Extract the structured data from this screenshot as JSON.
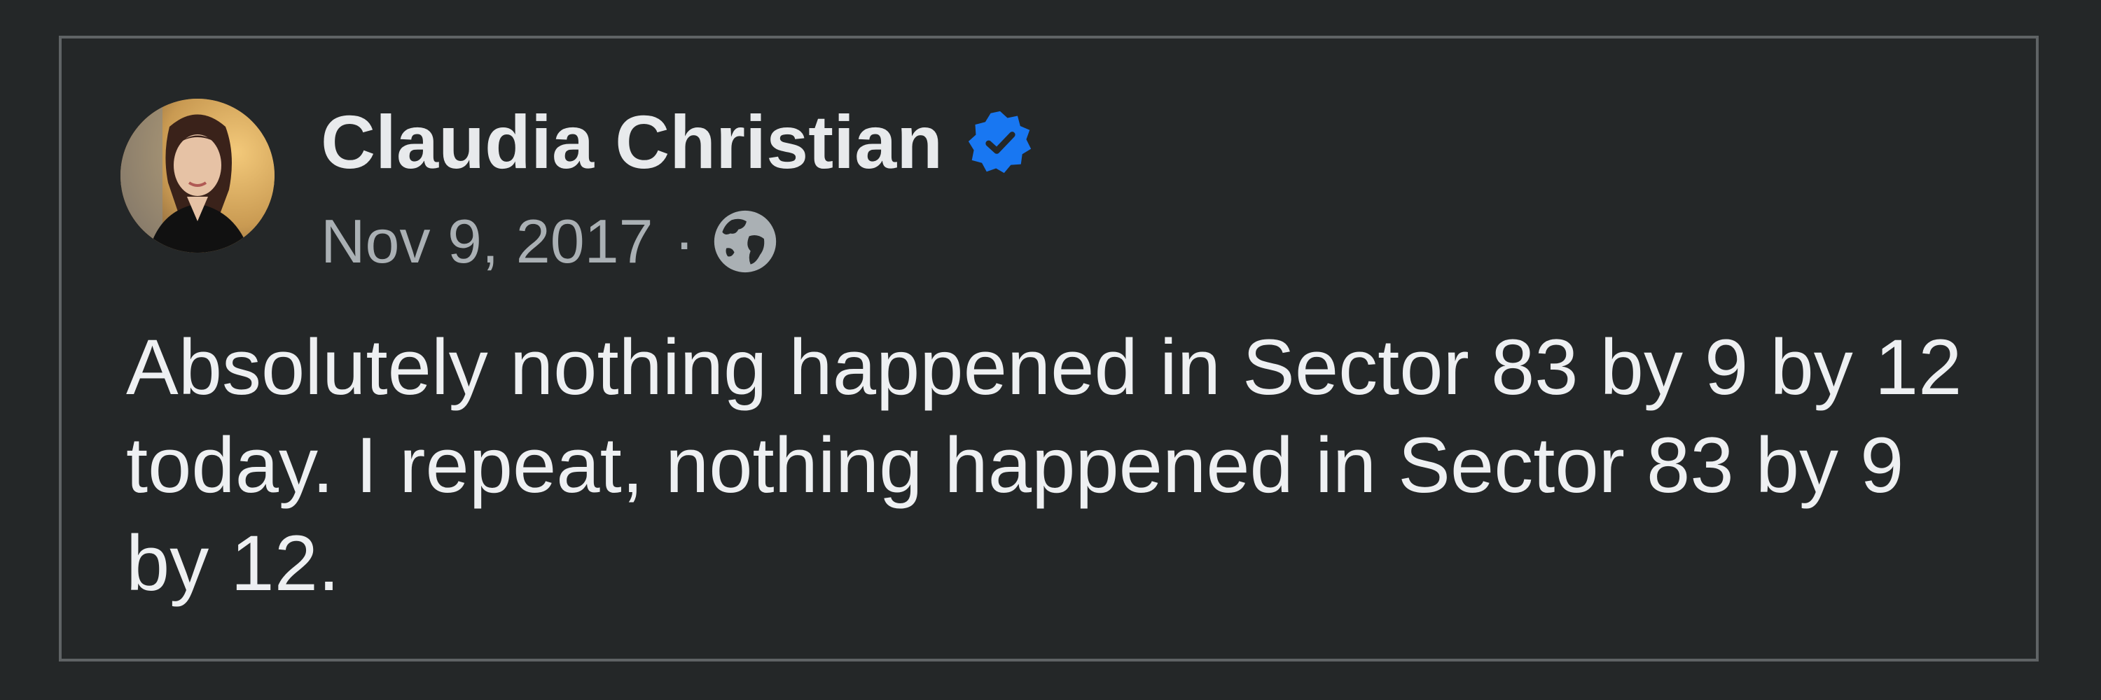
{
  "post": {
    "author": {
      "name": "Claudia Christian",
      "avatar_icon": "profile-photo",
      "verified_icon": "verified-badge-icon",
      "verified_color": "#1877f2"
    },
    "meta": {
      "date": "Nov 9, 2017",
      "separator": "·",
      "audience_icon": "globe-icon"
    },
    "text": "Absolutely nothing happened in Sector 83 by 9 by 12 today. I repeat, nothing happened in Sector 83 by 9 by 12."
  },
  "colors": {
    "background": "#242728",
    "border": "#5f6365",
    "primary_text": "#e8eaec",
    "secondary_text": "#aab0b4"
  }
}
